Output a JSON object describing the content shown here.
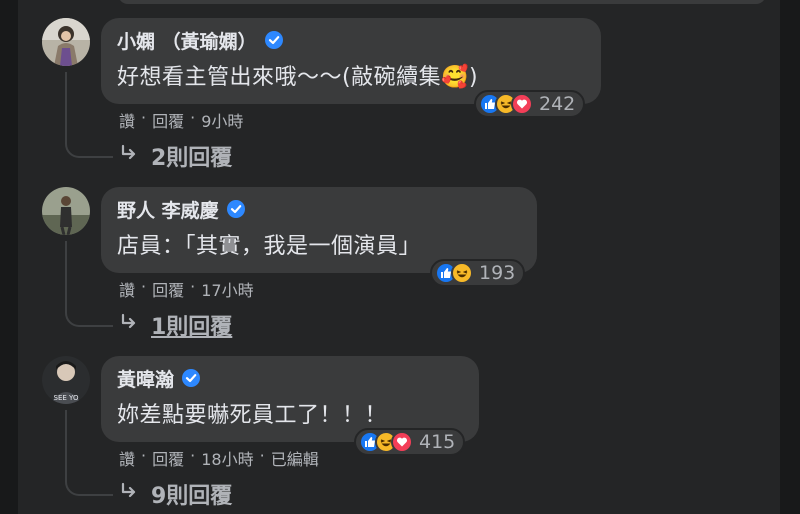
{
  "comments": [
    {
      "name": "小嫻 （黃瑜嫻）",
      "text": "好想看主管出來哦～～(敲碗續集🥰)",
      "reaction_count": "242",
      "reactions": [
        "like-icon",
        "haha-icon",
        "love-icon"
      ],
      "actions": {
        "like": "讚",
        "sep1": "·",
        "reply": "回覆",
        "sep2": "·",
        "time": "9小時",
        "sep3": "",
        "edited": ""
      },
      "replies_label": "2則回覆"
    },
    {
      "name": "野人 李威慶",
      "text": "店員：「其實，我是一個演員」",
      "reaction_count": "193",
      "reactions": [
        "like-icon",
        "haha-icon"
      ],
      "actions": {
        "like": "讚",
        "sep1": "·",
        "reply": "回覆",
        "sep2": "·",
        "time": "17小時",
        "sep3": "",
        "edited": ""
      },
      "replies_label": "1則回覆"
    },
    {
      "name": "黃暐瀚",
      "text": "妳差點要嚇死員工了！！！",
      "reaction_count": "415",
      "reactions": [
        "like-icon",
        "haha-icon",
        "love-icon"
      ],
      "actions": {
        "like": "讚",
        "sep1": "·",
        "reply": "回覆",
        "sep2": "·",
        "time": "18小時",
        "sep3": "·",
        "edited": "已編輯"
      },
      "replies_label": "9則回覆"
    }
  ],
  "colors": {
    "background": "#18191a",
    "panel": "#242526",
    "bubble": "#3a3b3c",
    "verified": "#2d88ff",
    "like": "#1877f2",
    "haha": "#f7b928",
    "love": "#f33e58"
  }
}
